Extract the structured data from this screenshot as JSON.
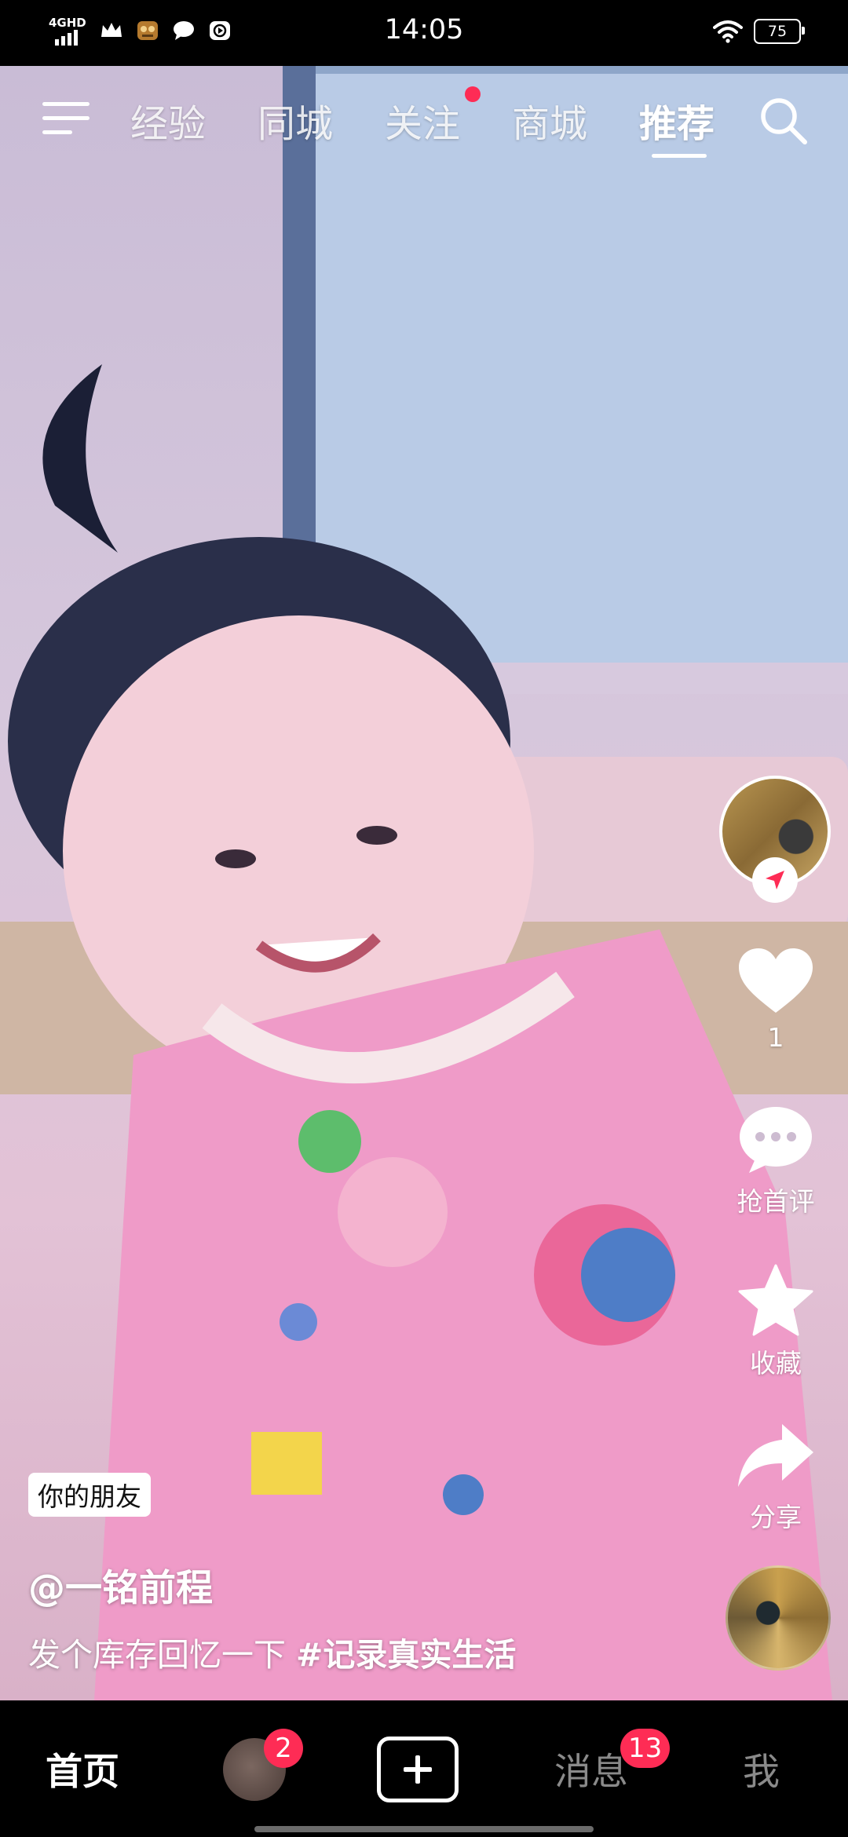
{
  "status_bar": {
    "network_label": "4GHD",
    "time": "14:05",
    "battery": "75",
    "icons": [
      "network-signal-icon",
      "crown-icon",
      "game-icon",
      "chat-icon",
      "video-app-icon",
      "wifi-icon",
      "battery-icon"
    ]
  },
  "top_nav": {
    "menu_icon": "menu-icon",
    "tabs": [
      {
        "label": "经验"
      },
      {
        "label": "同城"
      },
      {
        "label": "关注"
      },
      {
        "label": "商城"
      },
      {
        "label": "推荐"
      }
    ],
    "active_tab": "推荐",
    "search_icon": "search-icon",
    "accent_color": "#fe2c55"
  },
  "video": {
    "friend_badge": "你的朋友",
    "author": "@一铭前程",
    "caption_text": "发个库存回忆一下 ",
    "hashtag": "#记录真实生活"
  },
  "rail": {
    "like_count": "1",
    "comment_label": "抢首评",
    "favorite_label": "收藏",
    "share_label": "分享"
  },
  "bottom_nav": {
    "home": "首页",
    "friends_badge": "2",
    "create_icon": "plus-icon",
    "messages": "消息",
    "messages_badge": "13",
    "me": "我"
  }
}
